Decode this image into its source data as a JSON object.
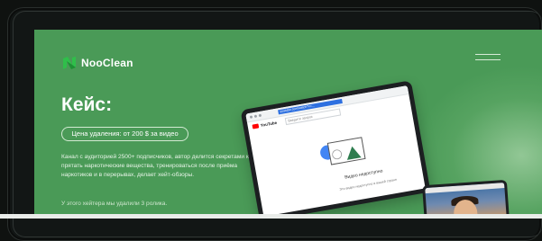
{
  "header": {
    "logo_text": "NooClean",
    "menu_icon": "hamburger-menu-icon"
  },
  "hero": {
    "title": "Кейс:",
    "price_badge": "Цена удаления: от 200 $ за видео",
    "description": "Канал с аудиторией 2500+ подписчиков, автор делится секретами как прятать наркотические вещества, тренироваться после приёма наркотиков и в перерывах, делает хейт-обзоры.",
    "footnote": "У этого хейтера мы удалили 3 ролика."
  },
  "tablet": {
    "url": "youtube.com/watch?v=...",
    "yt_label": "YouTube",
    "search_placeholder": "Введите запрос",
    "video_unavailable": "Видео недоступно",
    "video_sub": "Это видео недоступно в вашей стране"
  },
  "colors": {
    "screen_bg": "#4a9a57",
    "brand_green": "#2fbf4a",
    "text": "#ffffff"
  }
}
